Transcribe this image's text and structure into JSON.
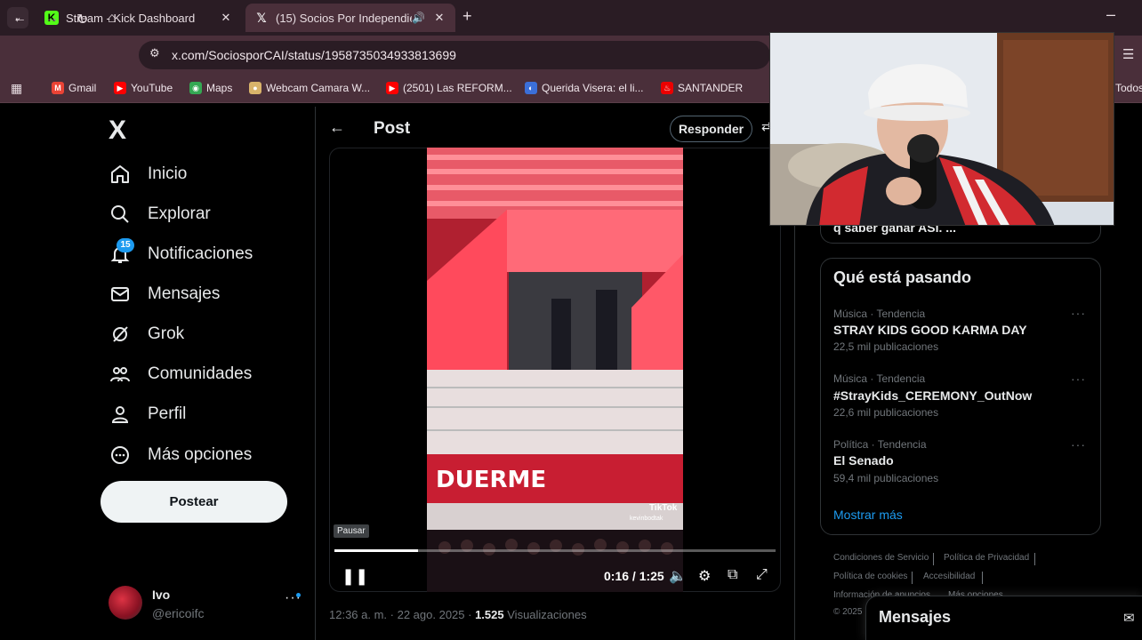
{
  "browser": {
    "tabs": [
      {
        "title": "Stream - Kick Dashboard",
        "favicon": "kick-icon",
        "active": false
      },
      {
        "title": "(15) Socios Por Independie",
        "favicon": "x-icon",
        "active": true,
        "audio": true
      }
    ],
    "url": "x.com/SociosporCAI/status/1958735034933813699",
    "bookmarks": [
      {
        "label": "Gmail",
        "icon": "gmail-icon",
        "color": "#ea4335"
      },
      {
        "label": "YouTube",
        "icon": "youtube-icon",
        "color": "#ff0000"
      },
      {
        "label": "Maps",
        "icon": "maps-icon",
        "color": "#34a853"
      },
      {
        "label": "Webcam Camara W...",
        "icon": "webcam-icon",
        "color": "#d9b36a"
      },
      {
        "label": "(2501) Las REFORM...",
        "icon": "youtube-icon",
        "color": "#ff0000"
      },
      {
        "label": "Querida Visera: el li...",
        "icon": "site-icon",
        "color": "#3b6fd8"
      },
      {
        "label": "SANTANDER",
        "icon": "santander-icon",
        "color": "#ec0000"
      }
    ],
    "bookmarks_all": "Todos",
    "colors": {
      "tabbar": "#2a1c24",
      "toolbar": "#4a2f3a"
    }
  },
  "sidebar": {
    "logo": "X",
    "items": [
      {
        "label": "Inicio",
        "icon": "home-icon"
      },
      {
        "label": "Explorar",
        "icon": "search-icon"
      },
      {
        "label": "Notificaciones",
        "icon": "bell-icon"
      },
      {
        "label": "Mensajes",
        "icon": "mail-icon"
      },
      {
        "label": "Grok",
        "icon": "grok-icon"
      },
      {
        "label": "Comunidades",
        "icon": "communities-icon"
      },
      {
        "label": "Perfil",
        "icon": "person-icon"
      },
      {
        "label": "Más opciones",
        "icon": "more-circle-icon"
      }
    ],
    "notification_badge": "15",
    "post_button": "Postear",
    "account": {
      "name": "Ivo",
      "handle": "@ericoifc"
    }
  },
  "post": {
    "header_title": "Post",
    "reply_button": "Responder",
    "video": {
      "tooltip": "Pausar",
      "current_time": "0:16",
      "duration": "1:25",
      "time_display": "0:16 / 1:25",
      "progress_fraction": 0.19,
      "watermark": "TikTok",
      "watermark_user": "kevinbodtak"
    },
    "meta": {
      "time": "12:36 a. m.",
      "date": "22 ago. 2025",
      "views_count": "1.525",
      "views_label": "Visualizaciones"
    }
  },
  "right": {
    "previous_card_text": "q saber ganar ASI. ...",
    "trends_title": "Qué está pasando",
    "trends": [
      {
        "category": "Música · Tendencia",
        "name": "STRAY KIDS GOOD KARMA DAY",
        "count": "22,5 mil publicaciones"
      },
      {
        "category": "Música · Tendencia",
        "name": "#StrayKids_CEREMONY_OutNow",
        "count": "22,6 mil publicaciones"
      },
      {
        "category": "Política · Tendencia",
        "name": "El Senado",
        "count": "59,4 mil publicaciones"
      }
    ],
    "show_more": "Mostrar más",
    "footer_links": [
      "Condiciones de Servicio",
      "Política de Privacidad",
      "Política de cookies",
      "Accesibilidad",
      "Información de anuncios",
      "Más opciones"
    ],
    "copyright": "© 2025"
  },
  "messages_drawer": {
    "title": "Mensajes"
  }
}
